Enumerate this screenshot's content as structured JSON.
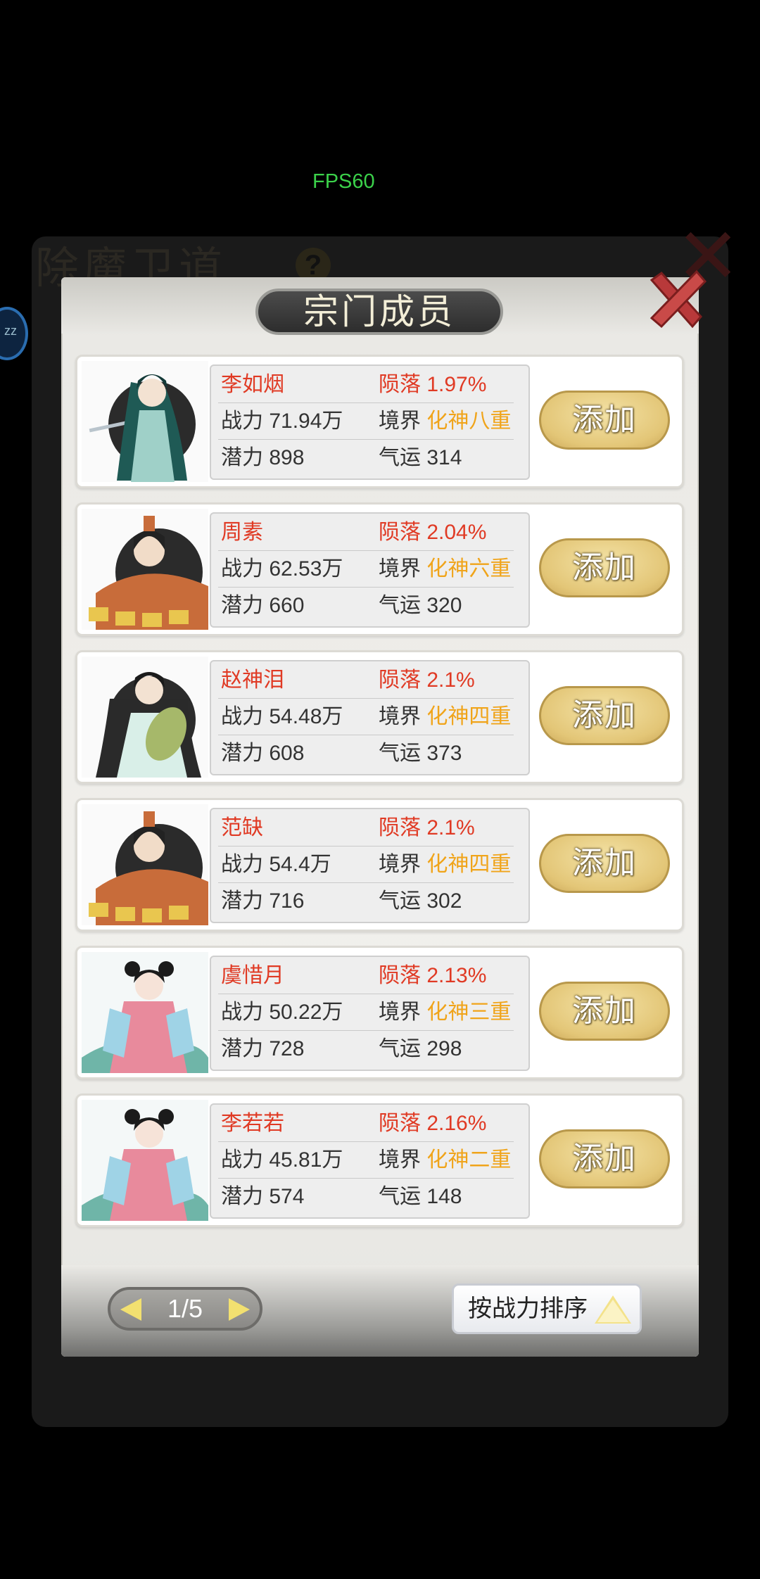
{
  "fps": "FPS60",
  "background": {
    "title": "除魔卫道",
    "help": "?"
  },
  "modal": {
    "title": "宗门成员"
  },
  "labels": {
    "fall": "陨落",
    "power": "战力",
    "realm": "境界",
    "potential": "潜力",
    "luck": "气运",
    "add": "添加"
  },
  "members": [
    {
      "name": "李如烟",
      "fall": "1.97%",
      "power": "71.94万",
      "realm": "化神八重",
      "potential": "898",
      "luck": "314",
      "portrait": "swordswoman-portrait"
    },
    {
      "name": "周素",
      "fall": "2.04%",
      "power": "62.53万",
      "realm": "化神六重",
      "potential": "660",
      "luck": "320",
      "portrait": "scholar-portrait"
    },
    {
      "name": "赵神泪",
      "fall": "2.1%",
      "power": "54.48万",
      "realm": "化神四重",
      "potential": "608",
      "luck": "373",
      "portrait": "pipa-player-portrait"
    },
    {
      "name": "范缺",
      "fall": "2.1%",
      "power": "54.4万",
      "realm": "化神四重",
      "potential": "716",
      "luck": "302",
      "portrait": "scholar-portrait"
    },
    {
      "name": "虞惜月",
      "fall": "2.13%",
      "power": "50.22万",
      "realm": "化神三重",
      "potential": "728",
      "luck": "298",
      "portrait": "maiden-portrait"
    },
    {
      "name": "李若若",
      "fall": "2.16%",
      "power": "45.81万",
      "realm": "化神二重",
      "potential": "574",
      "luck": "148",
      "portrait": "maiden-portrait"
    }
  ],
  "pager": {
    "text": "1/5"
  },
  "sort": {
    "label": "按战力排序"
  },
  "colors": {
    "name": "#e03a24",
    "realm": "#f0a41a",
    "button": "#e3c677"
  }
}
